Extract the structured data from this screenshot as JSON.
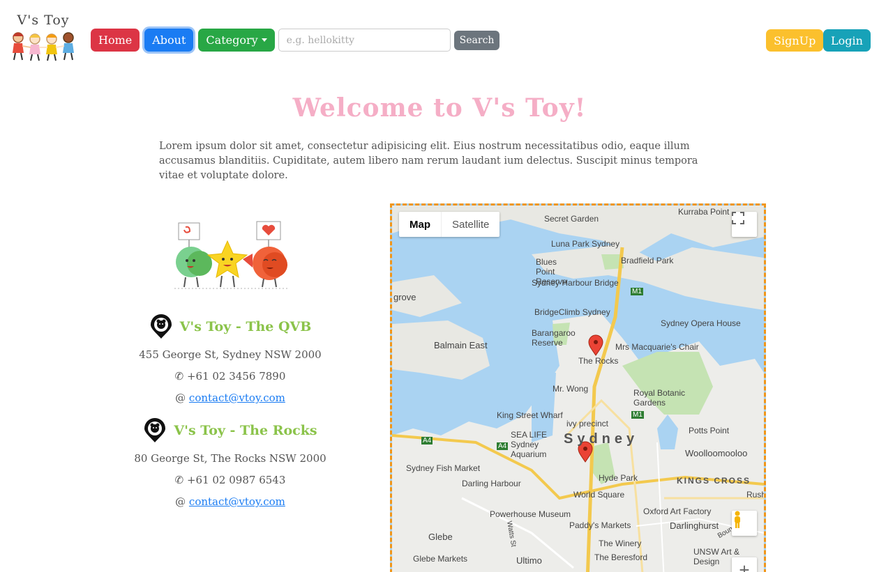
{
  "brand": {
    "title": "V's Toy"
  },
  "nav": {
    "home": "Home",
    "about": "About",
    "category": "Category",
    "search_placeholder": "e.g. hellokitty",
    "search": "Search",
    "signup": "SignUp",
    "login": "Login"
  },
  "welcome": "Welcome to V's Toy!",
  "intro": "Lorem ipsum dolor sit amet, consectetur adipisicing elit. Eius nostrum necessitatibus odio, eaque illum accusamus blanditiis. Cupiditate, autem libero nam rerum laudant ium delectus. Suscipit minus tempora vitae et voluptate dolore.",
  "stores": [
    {
      "name": "V's Toy - The QVB",
      "address": "455 George St, Sydney NSW 2000",
      "phone": "+61 02 3456 7890",
      "at": "@",
      "email": "contact@vtoy.com"
    },
    {
      "name": "V's Toy - The Rocks",
      "address": "80 George St, The Rocks NSW 2000",
      "phone": "+61 02 0987 6543",
      "at": "@",
      "email": "contact@vtoy.com"
    }
  ],
  "map": {
    "type_map": "Map",
    "type_satellite": "Satellite",
    "zoom_in": "+",
    "labels": {
      "kurraba": "Kurraba Point",
      "secret_garden": "Secret Garden",
      "luna_park": "Luna Park Sydney",
      "bradfield": "Bradfield Park",
      "blues_point": "Blues Point Reserve",
      "harbour_bridge": "Sydney Harbour Bridge",
      "grove": "grove",
      "bridgeclimb": "BridgeClimb Sydney",
      "opera": "Sydney Opera House",
      "balmain": "Balmain East",
      "barangaroo": "Barangaroo Reserve",
      "macquarie": "Mrs Macquarie's Chair",
      "rocks": "The Rocks",
      "mrwong": "Mr. Wong",
      "botanic": "Royal Botanic Gardens",
      "kingst": "King Street Wharf",
      "sealife": "SEA LIFE Sydney Aquarium",
      "ivy": "ivy precinct",
      "sydney": "Sydney",
      "potts": "Potts Point",
      "woolloomooloo": "Woolloomooloo",
      "fishmarket": "Sydney Fish Market",
      "darling": "Darling Harbour",
      "hyde": "Hyde Park",
      "kingscross": "KINGS CROSS",
      "worldsquare": "World Square",
      "oxford": "Oxford Art Factory",
      "powerhouse": "Powerhouse Museum",
      "paddys": "Paddy's Markets",
      "darlinghurst": "Darlinghurst",
      "glebe": "Glebe",
      "winery": "The Winery",
      "beresford": "The Beresford",
      "unsw": "UNSW Art & Design",
      "glebemarkets": "Glebe Markets",
      "ultimo": "Ultimo",
      "watts": "Watts St",
      "boundary": "Boundary St",
      "m1": "M1",
      "a4": "A4",
      "rush": "Rush"
    }
  }
}
